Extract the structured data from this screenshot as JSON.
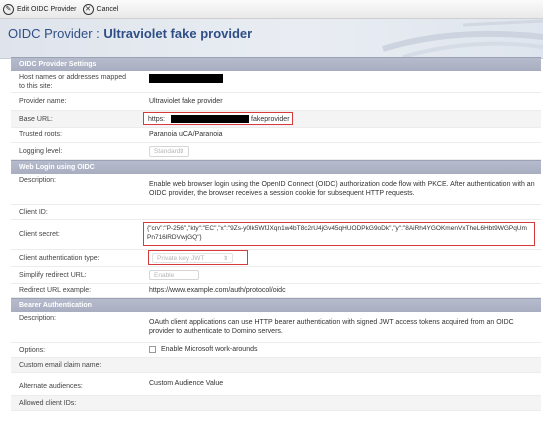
{
  "toolbar": {
    "edit_label": "Edit OIDC Provider",
    "cancel_label": "Cancel"
  },
  "header": {
    "title_prefix": "OIDC Provider :",
    "title_name": "Ultraviolet fake provider"
  },
  "sections": {
    "provider_settings": "OIDC Provider Settings",
    "web_login": "Web Login using OIDC",
    "bearer_auth": "Bearer Authentication"
  },
  "fields": {
    "host_names_label": "Host names or addresses mapped to this site:",
    "provider_name_label": "Provider name:",
    "provider_name_value": "Ultraviolet fake provider",
    "base_url_label": "Base URL:",
    "base_url_prefix": "https:",
    "base_url_suffix": "fakeprovider",
    "trusted_roots_label": "Trusted roots:",
    "trusted_roots_value": "Paranoia uCA/Paranoia",
    "logging_label": "Logging level:",
    "logging_value": "Standard",
    "web_description_label": "Description:",
    "web_description_value": "Enable web browser login using the OpenID Connect (OIDC) authorization code flow with PKCE. After authentication with an OIDC provider, the browser receives a session cookie for subsequent HTTP requests.",
    "client_id_label": "Client ID:",
    "client_secret_label": "Client secret:",
    "client_secret_value": "{\"crv\":\"P-256\",\"kty\":\"EC\",\"x\":\"9Zs-y0lk5WfJXqn1w4bT8c2rU4jGv45qHUODPkG9oDk\",\"y\":\"8AiRh4YGOKmenVxTheL6Hbt9WGPqUmPn716lRDVwjGQ\"}",
    "client_auth_type_label": "Client authentication type:",
    "client_auth_type_value": "Private key JWT",
    "simplify_label": "Simplify redirect URL:",
    "simplify_value": "Enable",
    "redirect_example_label": "Redirect URL example:",
    "redirect_example_value": "https://www.example.com/auth/protocol/oidc",
    "bearer_description_label": "Description:",
    "bearer_description_value": "OAuth client applications can use HTTP bearer authentication with signed JWT access tokens acquired from an OIDC provider to authenticate to Domino servers.",
    "options_label": "Options:",
    "options_checkbox_label": "Enable Microsoft work-arounds",
    "custom_email_label": "Custom email claim name:",
    "alternate_audiences_label": "Alternate audiences:",
    "alternate_audiences_value": "Custom Audience Value",
    "allowed_client_ids_label": "Allowed client IDs:"
  },
  "icons": {
    "edit": "pencil-circle-icon",
    "cancel": "x-circle-icon"
  },
  "colors": {
    "title": "#2f4f86",
    "section_bg": "#aab0c2",
    "highlight_border": "#d63b3b"
  }
}
